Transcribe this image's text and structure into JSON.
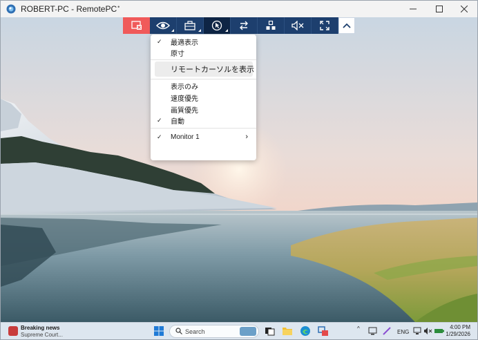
{
  "window": {
    "title": "ROBERT-PC - RemotePC"
  },
  "toolbar": {
    "buttons": [
      {
        "name": "disconnect",
        "icon": "disconnect-icon"
      },
      {
        "name": "view",
        "icon": "eye-icon"
      },
      {
        "name": "tools",
        "icon": "toolbox-icon"
      },
      {
        "name": "mouse",
        "icon": "mouse-icon"
      },
      {
        "name": "transfer",
        "icon": "arrows-icon"
      },
      {
        "name": "apps",
        "icon": "grid-icon"
      },
      {
        "name": "sound",
        "icon": "mute-icon"
      },
      {
        "name": "fullscreen",
        "icon": "fullscreen-icon"
      },
      {
        "name": "collapse",
        "icon": "chevron-up-icon"
      }
    ]
  },
  "menu": {
    "group1": [
      {
        "label": "最適表示",
        "checked": true
      },
      {
        "label": "原寸",
        "checked": false
      }
    ],
    "highlighted": "リモートカーソルを表示",
    "group2": [
      {
        "label": "表示のみ",
        "checked": false
      },
      {
        "label": "速度優先",
        "checked": false
      },
      {
        "label": "画質優先",
        "checked": false
      },
      {
        "label": "自動",
        "checked": true
      }
    ],
    "monitor": {
      "label": "Monitor 1",
      "checked": true,
      "arrow": "›"
    }
  },
  "checkmark": "✓",
  "taskbar": {
    "news_title": "Breaking news",
    "news_sub": "Supreme Court...",
    "search_label": "Search",
    "tray": {
      "lang": "ENG",
      "chevron": "^"
    },
    "time": "4:00 PM",
    "date": "1/29/2026"
  },
  "colors": {
    "toolbar": "#1d3f6e",
    "disconnect": "#f05a5a",
    "active": "#0e2545"
  }
}
